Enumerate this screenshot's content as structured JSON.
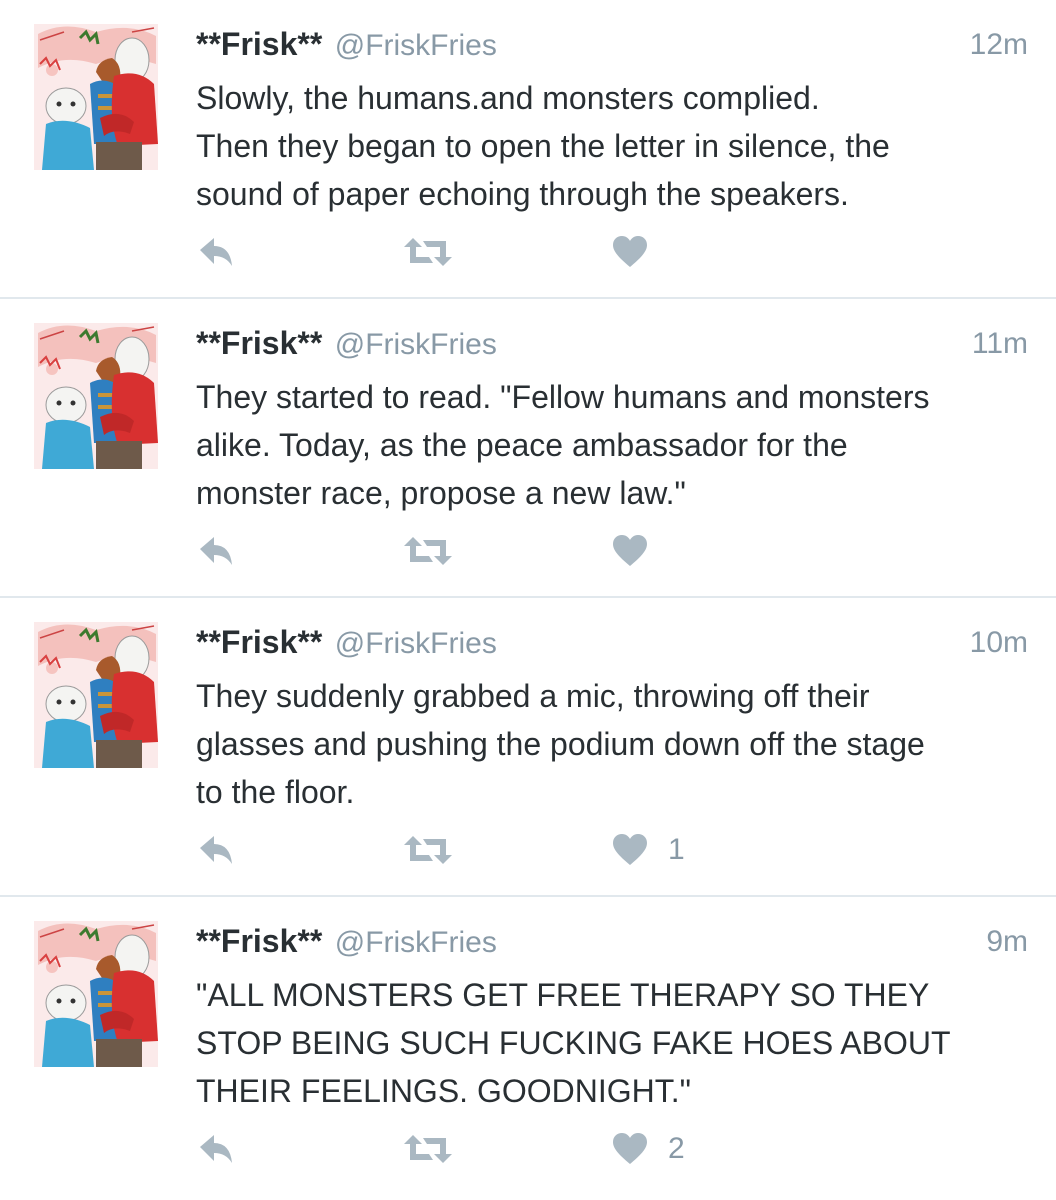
{
  "colors": {
    "text": "#292f33",
    "secondary": "#8899a6",
    "icon": "#aab8c2",
    "divider": "#e1e8ed"
  },
  "tweets": [
    {
      "display_name": "**Frisk**",
      "handle": "@FriskFries",
      "time": "12m",
      "lines": [
        "Slowly, the humans.and monsters complied.",
        "Then they began to open the letter in silence, the",
        "sound of paper echoing through the speakers."
      ],
      "like_count": ""
    },
    {
      "display_name": "**Frisk**",
      "handle": "@FriskFries",
      "time": "11m",
      "lines": [
        "They started to read. \"Fellow humans and monsters",
        "alike. Today, as the peace ambassador for the",
        "monster race, propose a new law.\""
      ],
      "like_count": ""
    },
    {
      "display_name": "**Frisk**",
      "handle": "@FriskFries",
      "time": "10m",
      "lines": [
        "They suddenly grabbed a mic, throwing off their",
        "glasses and pushing the podium down off the stage",
        "to the floor."
      ],
      "like_count": "1"
    },
    {
      "display_name": "**Frisk**",
      "handle": "@FriskFries",
      "time": "9m",
      "lines": [
        "\"ALL MONSTERS GET FREE THERAPY SO THEY",
        "STOP BEING SUCH FUCKING FAKE HOES ABOUT",
        "THEIR FEELINGS. GOODNIGHT.\""
      ],
      "like_count": "2"
    }
  ],
  "icons": {
    "reply": "reply-icon",
    "retweet": "retweet-icon",
    "like": "heart-icon"
  }
}
